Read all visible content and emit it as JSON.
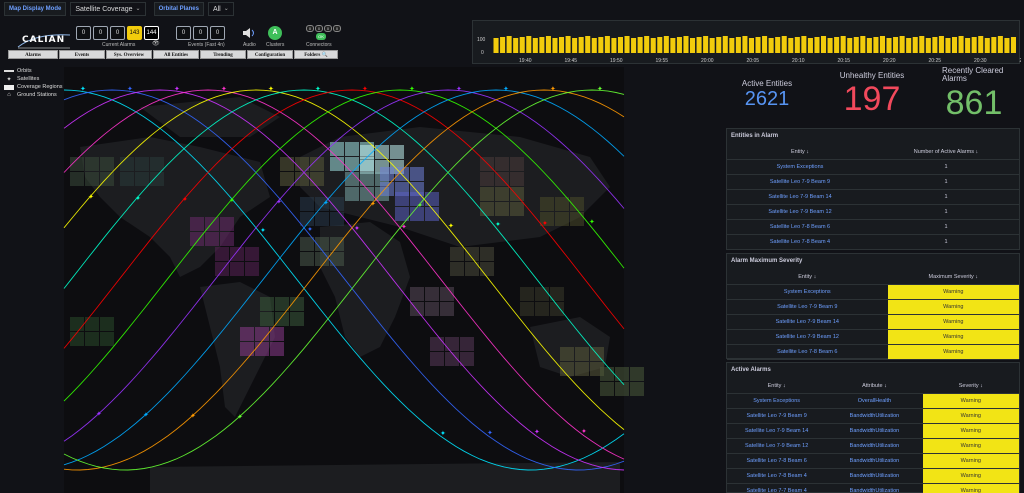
{
  "variables": {
    "map_display_mode_label": "Map Display Mode",
    "map_display_mode_value": "Satellite Coverage",
    "orbital_planes_label": "Orbital Planes",
    "orbital_planes_value": "All"
  },
  "control_panel": {
    "logo_text": "CALIAN",
    "current_alarms_counts": [
      "0",
      "0",
      "0",
      "143",
      "144"
    ],
    "current_alarms_label": "Current Alarms",
    "events_counts": [
      "0",
      "0",
      "0"
    ],
    "events_label": "Events (Fast 4n)",
    "audio_label": "Audio",
    "clusters_value": "A",
    "clusters_label": "Clusters",
    "connectors_dots": [
      "0",
      "0",
      "0",
      "0"
    ],
    "connectors_ok": "OK",
    "connectors_label": "Connectors",
    "nav_buttons": [
      "Alarms",
      "Events",
      "Sys. Overview",
      "All Entities",
      "Trending",
      "Configuration",
      "Folders"
    ]
  },
  "timeline": {
    "y_labels": [
      "100",
      "0"
    ],
    "x_labels": [
      "19:40",
      "19:45",
      "19:50",
      "19:55",
      "20:00",
      "20:05",
      "20:10",
      "20:15",
      "20:20",
      "20:25",
      "20:30",
      "20:35"
    ],
    "bar_color": "#f2cc0c"
  },
  "map": {
    "legend": [
      "Orbits",
      "Satellites",
      "Coverage Regions",
      "Ground Stations"
    ],
    "orbit_colors": [
      "#00e5ff",
      "#3366ff",
      "#cc33ff",
      "#ff33cc",
      "#ffff00",
      "#00ffcc",
      "#ff0000",
      "#33ff00",
      "#9933ff",
      "#00aaff",
      "#ff9900",
      "#66ff33",
      "#ff66ff",
      "#ffee00"
    ]
  },
  "stats": {
    "active_entities_label": "Active Entities",
    "active_entities_value": "2621",
    "active_color": "#5794f2",
    "unhealthy_label": "Unhealthy Entities",
    "unhealthy_value": "197",
    "unhealthy_color": "#f2495c",
    "cleared_label": "Recently Cleared Alarms",
    "cleared_value": "861",
    "cleared_color": "#73bf69"
  },
  "entities_in_alarm": {
    "title": "Entities in Alarm",
    "col_entity": "Entity",
    "col_count": "Number of Active Alarms",
    "rows": [
      {
        "entity": "System Exceptions",
        "count": "1"
      },
      {
        "entity": "Satellite Leo 7-9 Beam 9",
        "count": "1"
      },
      {
        "entity": "Satellite Leo 7-9 Beam 14",
        "count": "1"
      },
      {
        "entity": "Satellite Leo 7-9 Beam 12",
        "count": "1"
      },
      {
        "entity": "Satellite Leo 7-8 Beam 6",
        "count": "1"
      },
      {
        "entity": "Satellite Leo 7-8 Beam 4",
        "count": "1"
      }
    ]
  },
  "alarm_max_severity": {
    "title": "Alarm Maximum Severity",
    "col_entity": "Entity",
    "col_severity": "Maximum Severity",
    "rows": [
      {
        "entity": "System Exceptions",
        "severity": "Warning"
      },
      {
        "entity": "Satellite Leo 7-9 Beam 9",
        "severity": "Warning"
      },
      {
        "entity": "Satellite Leo 7-9 Beam 14",
        "severity": "Warning"
      },
      {
        "entity": "Satellite Leo 7-9 Beam 12",
        "severity": "Warning"
      },
      {
        "entity": "Satellite Leo 7-8 Beam 6",
        "severity": "Warning"
      }
    ]
  },
  "active_alarms": {
    "title": "Active Alarms",
    "col_entity": "Entity",
    "col_attribute": "Attribute",
    "col_severity": "Severity",
    "rows": [
      {
        "entity": "System Exceptions",
        "attribute": "OverallHealth",
        "severity": "Warning"
      },
      {
        "entity": "Satellite Leo 7-9 Beam 9",
        "attribute": "BandwidthUtilization",
        "severity": "Warning"
      },
      {
        "entity": "Satellite Leo 7-9 Beam 14",
        "attribute": "BandwidthUtilization",
        "severity": "Warning"
      },
      {
        "entity": "Satellite Leo 7-9 Beam 12",
        "attribute": "BandwidthUtilization",
        "severity": "Warning"
      },
      {
        "entity": "Satellite Leo 7-8 Beam 6",
        "attribute": "BandwidthUtilization",
        "severity": "Warning"
      },
      {
        "entity": "Satellite Leo 7-8 Beam 4",
        "attribute": "BandwidthUtilization",
        "severity": "Warning"
      },
      {
        "entity": "Satellite Leo 7-7 Beam 4",
        "attribute": "BandwidthUtilization",
        "severity": "Warning"
      }
    ]
  }
}
